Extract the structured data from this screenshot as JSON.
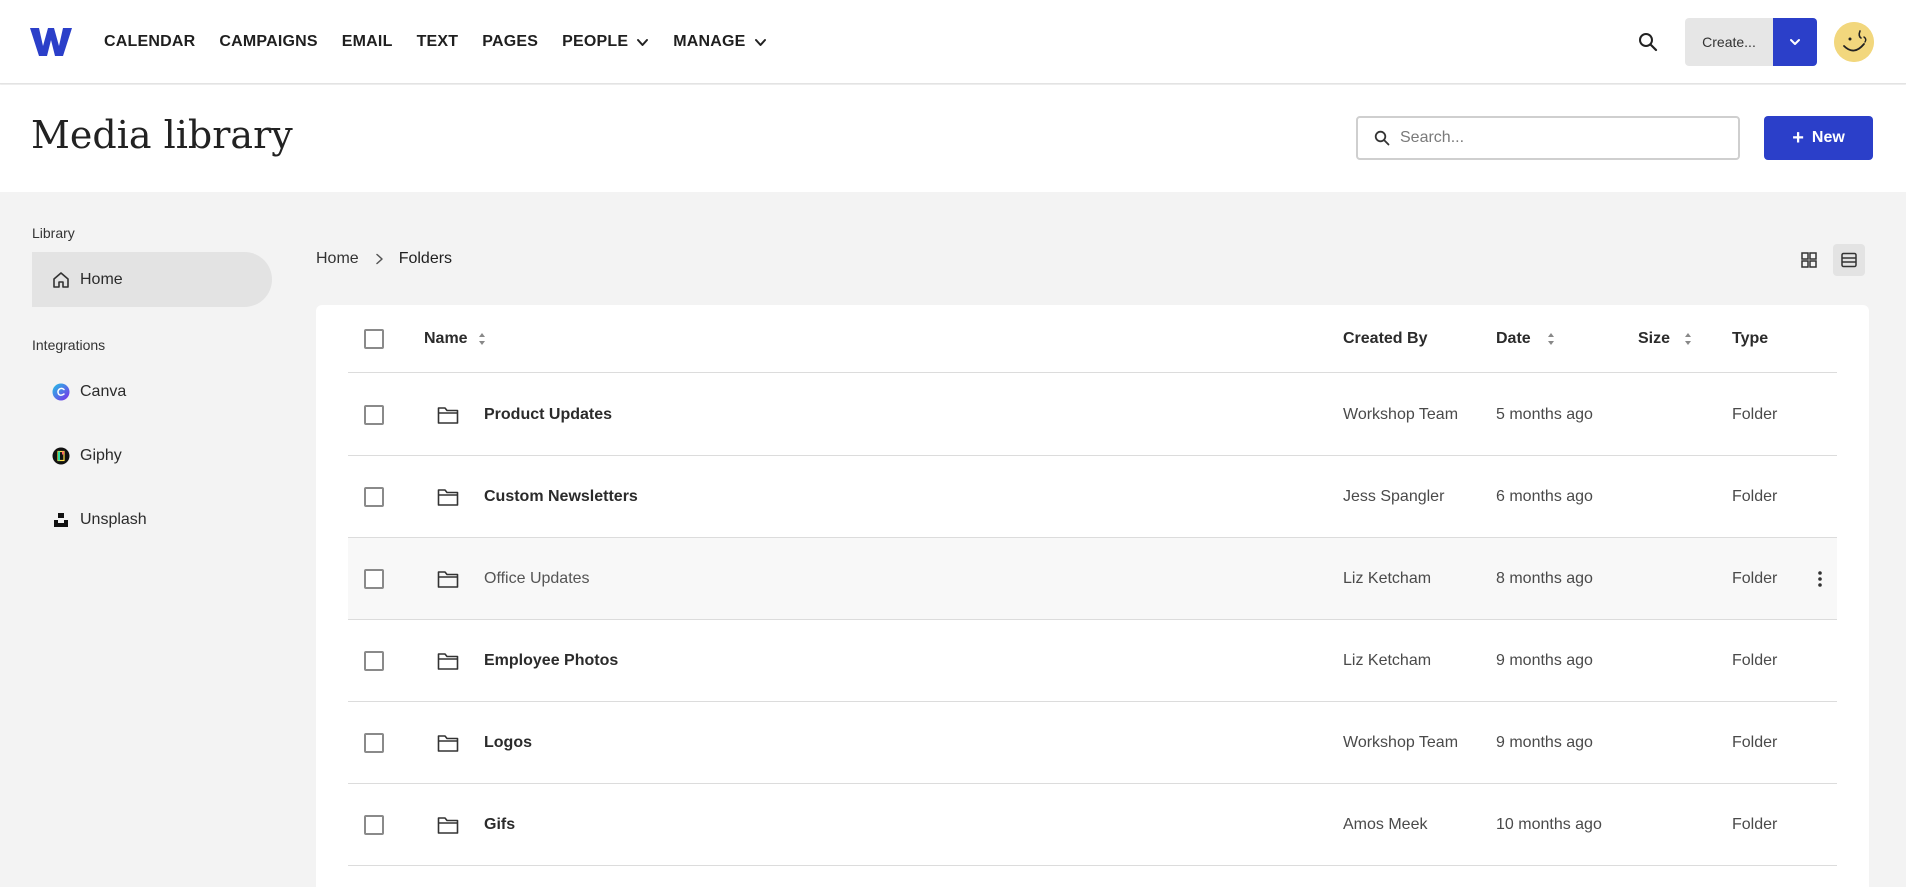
{
  "nav": {
    "logo_letter": "W",
    "items": [
      {
        "label": "CALENDAR",
        "dropdown": false
      },
      {
        "label": "CAMPAIGNS",
        "dropdown": false
      },
      {
        "label": "EMAIL",
        "dropdown": false
      },
      {
        "label": "TEXT",
        "dropdown": false
      },
      {
        "label": "PAGES",
        "dropdown": false
      },
      {
        "label": "PEOPLE",
        "dropdown": true
      },
      {
        "label": "MANAGE",
        "dropdown": true
      }
    ],
    "create_label": "Create...",
    "accent_color": "#2b3fc9"
  },
  "header": {
    "title": "Media library",
    "search_placeholder": "Search...",
    "new_label": "New"
  },
  "sidebar": {
    "library_label": "Library",
    "home_label": "Home",
    "integrations_label": "Integrations",
    "integrations": [
      {
        "label": "Canva",
        "icon": "canva-icon"
      },
      {
        "label": "Giphy",
        "icon": "giphy-icon"
      },
      {
        "label": "Unsplash",
        "icon": "unsplash-icon"
      }
    ]
  },
  "breadcrumb": {
    "home": "Home",
    "current": "Folders"
  },
  "table": {
    "columns": {
      "name": "Name",
      "created_by": "Created By",
      "date": "Date",
      "size": "Size",
      "type": "Type"
    },
    "rows": [
      {
        "name": "Product Updates",
        "created_by": "Workshop Team",
        "date": "5 months ago",
        "size": "",
        "type": "Folder"
      },
      {
        "name": "Custom Newsletters",
        "created_by": "Jess Spangler",
        "date": "6 months ago",
        "size": "",
        "type": "Folder"
      },
      {
        "name": "Office Updates",
        "created_by": "Liz Ketcham",
        "date": "8 months ago",
        "size": "",
        "type": "Folder"
      },
      {
        "name": "Employee Photos",
        "created_by": "Liz Ketcham",
        "date": "9 months ago",
        "size": "",
        "type": "Folder"
      },
      {
        "name": "Logos",
        "created_by": "Workshop Team",
        "date": "9 months ago",
        "size": "",
        "type": "Folder"
      },
      {
        "name": "Gifs",
        "created_by": "Amos Meek",
        "date": "10 months ago",
        "size": "",
        "type": "Folder"
      }
    ]
  }
}
